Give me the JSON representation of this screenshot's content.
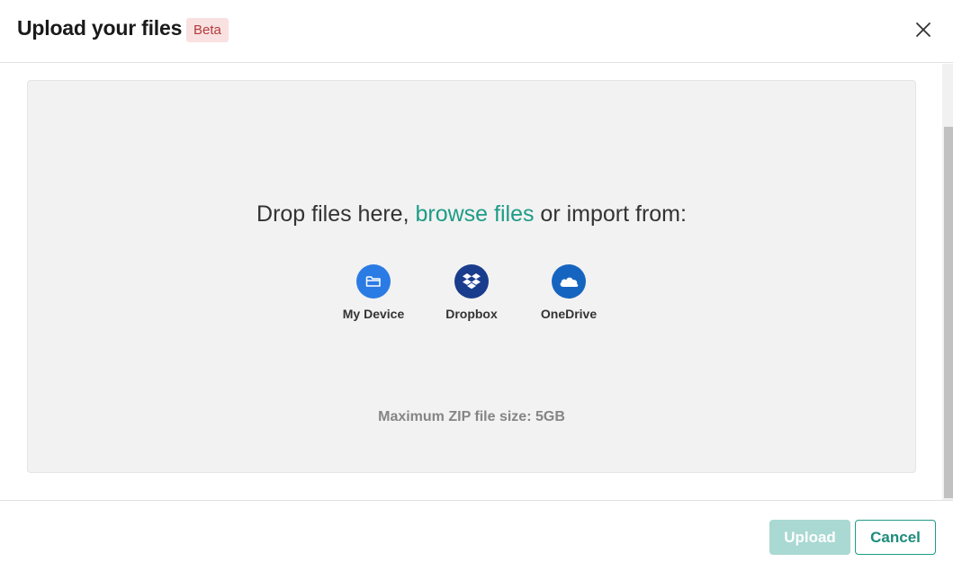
{
  "dialog": {
    "title": "Upload your files",
    "badge": "Beta"
  },
  "dropzone": {
    "text_before": "Drop files here, ",
    "browse_link": "browse files",
    "text_after": " or import from:",
    "sources": [
      {
        "label": "My Device",
        "icon": "folder-icon",
        "color": "#2b7be4"
      },
      {
        "label": "Dropbox",
        "icon": "dropbox-icon",
        "color": "#1a3c8c"
      },
      {
        "label": "OneDrive",
        "icon": "onedrive-cloud-icon",
        "color": "#1565c0"
      }
    ],
    "max_size_note": "Maximum ZIP file size: 5GB"
  },
  "footer": {
    "upload_label": "Upload",
    "cancel_label": "Cancel"
  },
  "colors": {
    "accent": "#1e9c87",
    "upload_disabled": "#a9d9d2",
    "badge_bg": "#f9e1e1",
    "badge_text": "#b23b3b",
    "dropzone_bg": "#f2f2f2"
  }
}
